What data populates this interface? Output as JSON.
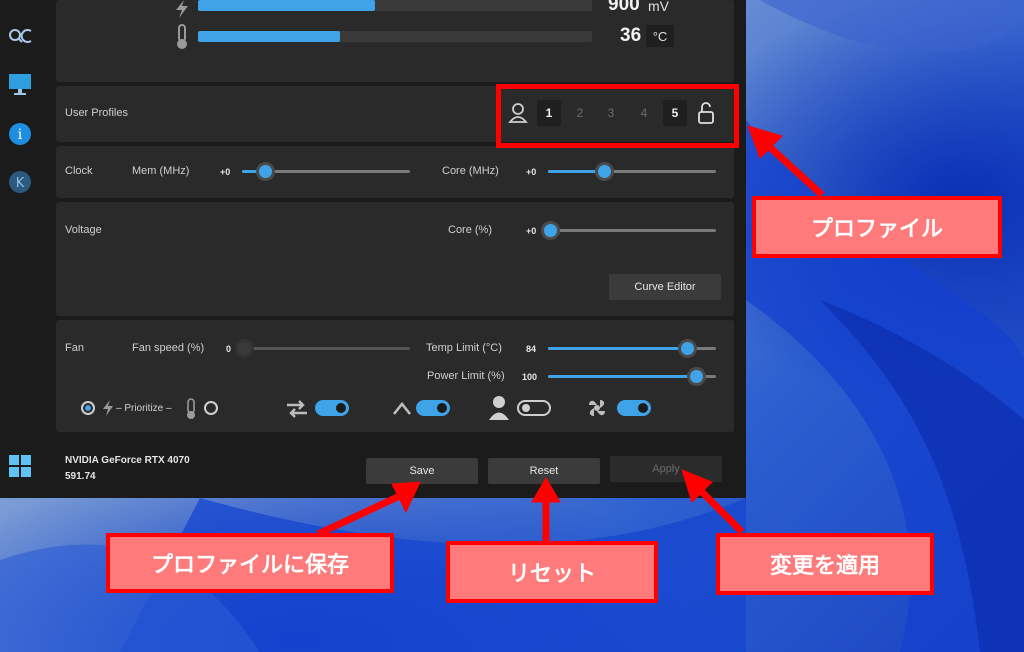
{
  "monitor": {
    "voltage_value": "900",
    "voltage_unit": "mV",
    "temp_value": "36",
    "temp_unit": "°C",
    "voltage_fill": 0.45,
    "temp_fill": 0.36
  },
  "user_profiles": {
    "label": "User Profiles",
    "slots": [
      "1",
      "2",
      "3",
      "4",
      "5"
    ],
    "active_slots": [
      "1",
      "5"
    ]
  },
  "clock": {
    "label": "Clock",
    "mem_label": "Mem (MHz)",
    "mem_value": "+0",
    "core_label": "Core (MHz)",
    "core_value": "+0"
  },
  "voltage": {
    "label": "Voltage",
    "core_label": "Core (%)",
    "core_value": "+0",
    "curve_editor": "Curve Editor"
  },
  "fan": {
    "label": "Fan",
    "speed_label": "Fan speed (%)",
    "speed_value": "0",
    "temp_limit_label": "Temp Limit (°C)",
    "temp_limit_value": "84",
    "power_limit_label": "Power Limit (%)",
    "power_limit_value": "100",
    "prioritize": "– Prioritize –",
    "temp_limit_fill": 0.83,
    "power_limit_fill": 0.88
  },
  "gpu": {
    "name": "NVIDIA GeForce RTX 4070",
    "driver": "591.74"
  },
  "actions": {
    "save": "Save",
    "reset": "Reset",
    "apply": "Apply"
  },
  "annotations": {
    "profile": "プロファイル",
    "save": "プロファイルに保存",
    "reset": "リセット",
    "apply": "変更を適用"
  },
  "colors": {
    "accent": "#3fa3e8",
    "annotation_red": "#ff0000",
    "annotation_fill": "#ff7b7b"
  }
}
